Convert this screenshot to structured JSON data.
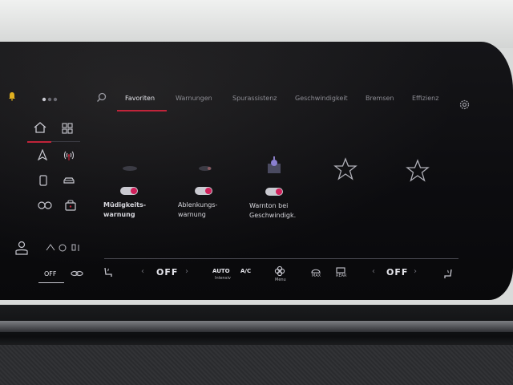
{
  "tabs": [
    {
      "label": "Favoriten",
      "active": true
    },
    {
      "label": "Warnungen",
      "active": false
    },
    {
      "label": "Spurassistenz",
      "active": false
    },
    {
      "label": "Geschwindigkeit",
      "active": false
    },
    {
      "label": "Bremsen",
      "active": false
    },
    {
      "label": "Effizienz",
      "active": false
    }
  ],
  "favorites": [
    {
      "label_line1": "Müdigkeits-",
      "label_line2": "warnung",
      "toggle_on": true
    },
    {
      "label_line1": "Ablenkungs-",
      "label_line2": "warnung",
      "toggle_on": true
    },
    {
      "label_line1": "Warnton bei",
      "label_line2": "Geschwindigk.",
      "toggle_on": true
    }
  ],
  "left_bottom": {
    "off_label": "OFF"
  },
  "climate": {
    "left_temp": "OFF",
    "auto_label": "AUTO",
    "auto_sub": "Intensiv",
    "ac_label": "A/C",
    "menu_label": "Menu",
    "max_label": "MAX",
    "rear_label": "REAR",
    "right_temp": "OFF"
  },
  "colors": {
    "accent": "#c0243a",
    "toggle_knob": "#d0205a"
  }
}
